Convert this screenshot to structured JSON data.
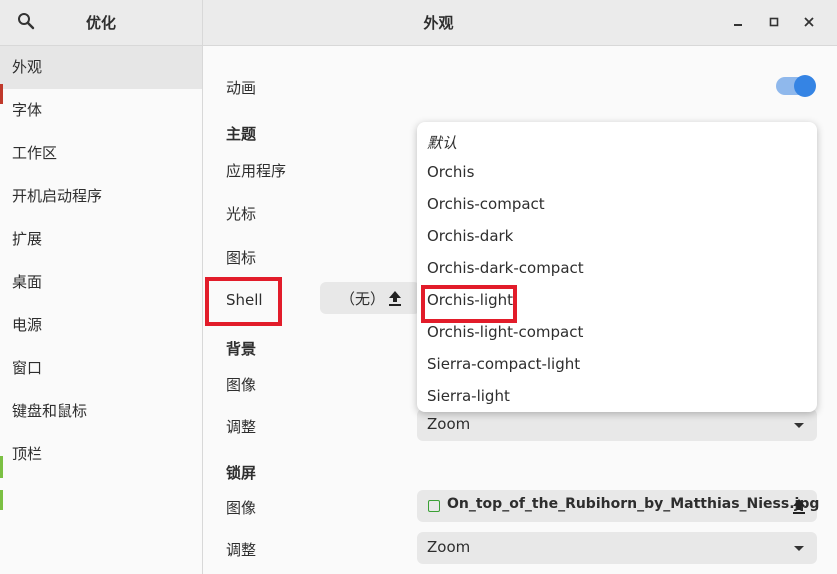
{
  "app": {
    "title": "优化"
  },
  "window": {
    "title": "外观"
  },
  "sidebar": {
    "items": [
      {
        "label": "外观",
        "active": true
      },
      {
        "label": "字体"
      },
      {
        "label": "工作区"
      },
      {
        "label": "开机启动程序"
      },
      {
        "label": "扩展"
      },
      {
        "label": "桌面"
      },
      {
        "label": "电源"
      },
      {
        "label": "窗口"
      },
      {
        "label": "键盘和鼠标"
      },
      {
        "label": "顶栏"
      }
    ]
  },
  "main": {
    "animation_label": "动画",
    "animation_enabled": true,
    "themes_heading": "主题",
    "applications_label": "应用程序",
    "cursor_label": "光标",
    "icons_label": "图标",
    "shell_label": "Shell",
    "shell_value": "（无）",
    "background_heading": "背景",
    "bg_image_label": "图像",
    "bg_adjust_label": "调整",
    "bg_adjust_value": "Zoom",
    "lockscreen_heading": "锁屏",
    "ls_image_label": "图像",
    "ls_image_value": "On_top_of_the_Rubihorn_by_Matthias_Niess.jpg",
    "ls_adjust_label": "调整",
    "ls_adjust_value": "Zoom"
  },
  "popover": {
    "items": [
      {
        "label": "默认",
        "italic": true
      },
      {
        "label": "Orchis"
      },
      {
        "label": "Orchis-compact"
      },
      {
        "label": "Orchis-dark"
      },
      {
        "label": "Orchis-dark-compact"
      },
      {
        "label": "Orchis-light",
        "highlighted": true
      },
      {
        "label": "Orchis-light-compact"
      },
      {
        "label": "Sierra-compact-light"
      },
      {
        "label": "Sierra-light"
      }
    ]
  },
  "colors": {
    "accent": "#3584e4",
    "highlight_box": "#e21c2a"
  }
}
